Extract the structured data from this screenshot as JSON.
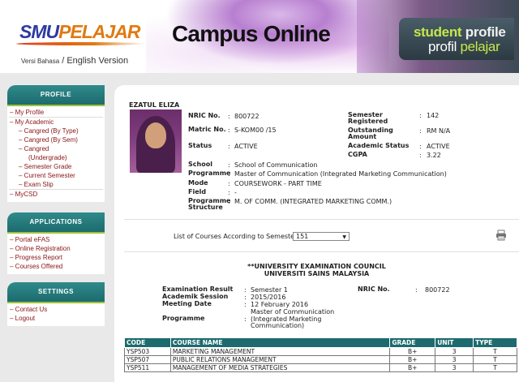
{
  "header": {
    "logo_part1": "SMU",
    "logo_part2": "PELAJAR",
    "language": {
      "malay": "Versi Bahasa",
      "separator": "/",
      "english": "English Version"
    },
    "site_title": "Campus Online",
    "badge": {
      "line1_a": "student",
      "line1_b": "profile",
      "line2_a": "profil",
      "line2_b": "pelajar"
    }
  },
  "sidebar": {
    "profile": {
      "title": "PROFILE",
      "items": [
        {
          "label": "My Profile"
        },
        {
          "label": "My Academic"
        },
        {
          "label": "Cangred (By Type)"
        },
        {
          "label": "Cangred (By Sem)"
        },
        {
          "label": "Cangred"
        },
        {
          "label": "(Undergrade)"
        },
        {
          "label": "Semester Grade"
        },
        {
          "label": "Current Semester"
        },
        {
          "label": "Exam Slip"
        },
        {
          "label": "MyCSD"
        }
      ]
    },
    "applications": {
      "title": "APPLICATIONS",
      "items": [
        {
          "label": "Portal eFAS"
        },
        {
          "label": "Online Registration"
        },
        {
          "label": "Progress Report"
        },
        {
          "label": "Courses Offered"
        }
      ]
    },
    "settings": {
      "title": "SETTINGS",
      "items": [
        {
          "label": "Contact Us"
        },
        {
          "label": "Logout"
        }
      ]
    }
  },
  "student": {
    "name": "EZATUL ELIZA",
    "labels": {
      "nric": "NRIC No.",
      "matric": "Matric No.",
      "status": "Status",
      "semester": "Semester",
      "registered": "Registered",
      "outstanding": "Outstanding",
      "amount": "Amount",
      "academic_status": "Academic Status",
      "cgpa": "CGPA",
      "school": "School",
      "programme": "Programme",
      "mode": "Mode",
      "field": "Field",
      "programme_structure_1": "Programme",
      "programme_structure_2": "Structure"
    },
    "values": {
      "nric": "800722",
      "matric": "S-KOM00   /15",
      "status": "ACTIVE",
      "semester_registered": "142",
      "outstanding_amount": "RM N/A",
      "academic_status": "ACTIVE",
      "cgpa": "3.22",
      "school": "School of Communication",
      "programme": "Master of Communication (Integrated Marketing Communication)",
      "mode": "COURSEWORK - PART TIME",
      "field": "-",
      "programme_structure": "M. OF COMM. (INTEGRATED MARKETING COMM.)"
    }
  },
  "course_filter": {
    "label": "List of Courses According to Semester",
    "selected": "151"
  },
  "exam": {
    "council": "**UNIVERSITY EXAMINATION COUNCIL",
    "university": "UNIVERSITI SAINS MALAYSIA",
    "labels": {
      "result": "Examination Result",
      "session": "Academik Session",
      "meeting": "Meeting Date",
      "programme": "Programme",
      "nric": "NRIC No."
    },
    "values": {
      "result": "Semester 1",
      "session": "2015/2016",
      "meeting": "12 February 2016",
      "programme_1": "Master of Communication",
      "programme_2": "(Integrated Marketing",
      "programme_3": "Communication)",
      "nric": "800722"
    }
  },
  "courses": {
    "headers": {
      "code": "CODE",
      "name": "COURSE NAME",
      "grade": "GRADE",
      "unit": "UNIT",
      "type": "TYPE"
    },
    "rows": [
      {
        "code": "YSP503",
        "name": "MARKETING MANAGEMENT",
        "grade": "B+",
        "unit": "3",
        "type": "T"
      },
      {
        "code": "YSP507",
        "name": "PUBLIC RELATIONS MANAGEMENT",
        "grade": "B+",
        "unit": "3",
        "type": "T"
      },
      {
        "code": "YSP511",
        "name": "MANAGEMENT OF MEDIA STRATEGIES",
        "grade": "B+",
        "unit": "3",
        "type": "T"
      }
    ]
  }
}
